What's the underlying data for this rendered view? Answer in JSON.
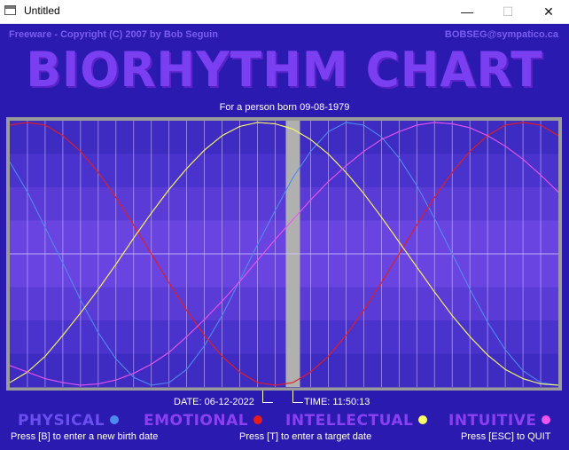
{
  "window": {
    "title": "Untitled",
    "controls": {
      "minimize": "—",
      "maximize": "☐",
      "close": "✕"
    }
  },
  "header": {
    "left": "Freeware - Copyright (C) 2007 by Bob Seguin",
    "right": "BOBSEG@sympatico.ca",
    "title": "BIORHYTHM CHART",
    "subtitle": "For a person born 09-08-1979"
  },
  "chart_labels": {
    "date": "DATE: 06-12-2022",
    "time": "TIME: 11:50:13"
  },
  "legend": [
    {
      "label": "PHYSICAL",
      "color": "#4f8af0"
    },
    {
      "label": "EMOTIONAL",
      "color": "#e81b1b"
    },
    {
      "label": "INTELLECTUAL",
      "color": "#ffff66"
    },
    {
      "label": "INTUITIVE",
      "color": "#ee55ee"
    }
  ],
  "instructions": {
    "birth": "Press [B] to enter a new birth date",
    "target": "Press [T] to enter a target date",
    "quit": "Press [ESC] to QUIT"
  },
  "chart_data": {
    "type": "line",
    "days_shown": 31,
    "center_day": 16,
    "series": [
      {
        "name": "PHYSICAL",
        "period_days": 23,
        "color": "#4f8af0",
        "values": [
          0.7,
          0.47,
          0.2,
          -0.07,
          -0.35,
          -0.6,
          -0.8,
          -0.94,
          -1.0,
          -0.98,
          -0.88,
          -0.7,
          -0.47,
          -0.2,
          0.07,
          0.33,
          0.58,
          0.78,
          0.93,
          1.0,
          0.98,
          0.89,
          0.73,
          0.52,
          0.27,
          0.0,
          -0.27,
          -0.52,
          -0.73,
          -0.89,
          -0.98,
          -1.0
        ]
      },
      {
        "name": "EMOTIONAL",
        "period_days": 28,
        "color": "#e81b1b",
        "values": [
          0.98,
          1.0,
          0.98,
          0.9,
          0.78,
          0.62,
          0.43,
          0.22,
          0.0,
          -0.22,
          -0.43,
          -0.62,
          -0.78,
          -0.9,
          -0.98,
          -1.0,
          -0.98,
          -0.9,
          -0.78,
          -0.62,
          -0.43,
          -0.22,
          0.0,
          0.22,
          0.43,
          0.62,
          0.78,
          0.9,
          0.98,
          1.0,
          0.98,
          0.9
        ]
      },
      {
        "name": "INTELLECTUAL",
        "period_days": 33,
        "color": "#ffff66",
        "values": [
          -0.98,
          -0.9,
          -0.78,
          -0.62,
          -0.45,
          -0.27,
          -0.08,
          0.12,
          0.31,
          0.49,
          0.65,
          0.79,
          0.9,
          0.97,
          1.0,
          0.99,
          0.95,
          0.87,
          0.76,
          0.62,
          0.46,
          0.28,
          0.09,
          -0.1,
          -0.29,
          -0.47,
          -0.63,
          -0.77,
          -0.88,
          -0.95,
          -0.99,
          -1.0
        ]
      },
      {
        "name": "INTUITIVE",
        "period_days": 38,
        "color": "#ee55ee",
        "values": [
          -0.85,
          -0.9,
          -0.95,
          -0.98,
          -1.0,
          -0.99,
          -0.96,
          -0.91,
          -0.84,
          -0.75,
          -0.63,
          -0.5,
          -0.36,
          -0.21,
          -0.05,
          0.11,
          0.26,
          0.41,
          0.55,
          0.67,
          0.78,
          0.87,
          0.93,
          0.98,
          1.0,
          0.99,
          0.96,
          0.9,
          0.82,
          0.72,
          0.6,
          0.47
        ]
      }
    ],
    "ylim": [
      -1,
      1
    ],
    "grid": true
  }
}
